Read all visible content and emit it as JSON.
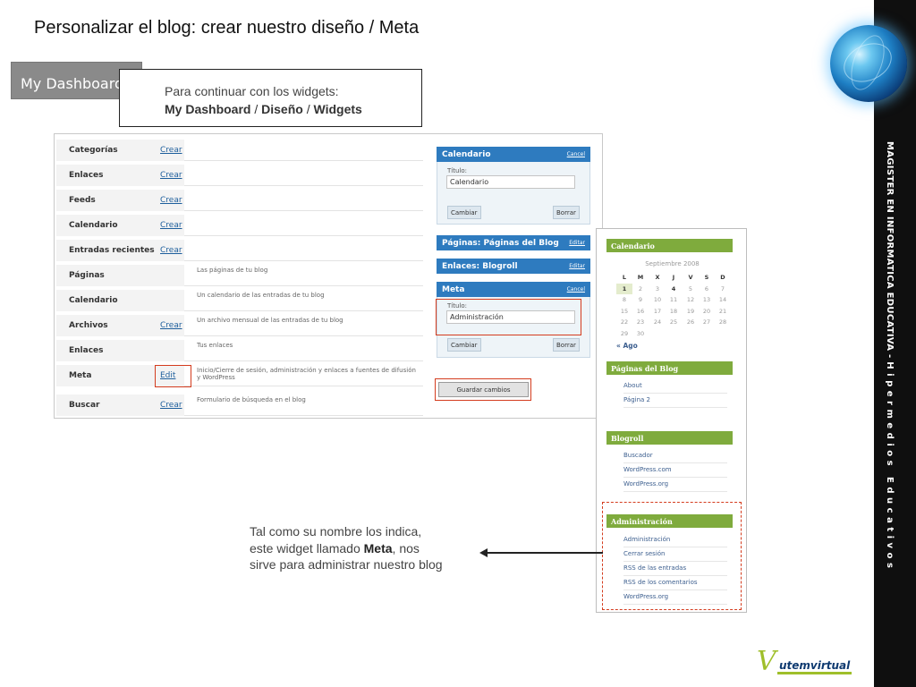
{
  "slide": {
    "title": "Personalizar el blog: crear nuestro diseño / Meta",
    "side_text_1": "MAGISTER EN INFORMATICA EDUCATIVA  -  ",
    "side_text_2": "Hipermedios Educativos",
    "logo_text": "utemvirtual"
  },
  "dashboard_button": {
    "label": "My Dashboard"
  },
  "callout": {
    "line1": "Para continuar con los widgets:",
    "path": [
      "My Dashboard",
      "Diseño",
      "Widgets"
    ],
    "separator": " / "
  },
  "widgets": [
    {
      "name": "Categorías",
      "link": "Crear",
      "desc": ""
    },
    {
      "name": "Enlaces",
      "link": "Crear",
      "desc": ""
    },
    {
      "name": "Feeds",
      "link": "Crear",
      "desc": ""
    },
    {
      "name": "Calendario",
      "link": "Crear",
      "desc": ""
    },
    {
      "name": "Entradas recientes",
      "link": "Crear",
      "desc": ""
    },
    {
      "name": "Páginas",
      "link": "",
      "desc": "Las páginas de tu blog"
    },
    {
      "name": "Calendario",
      "link": "",
      "desc": "Un calendario de las entradas de tu blog"
    },
    {
      "name": "Archivos",
      "link": "Crear",
      "desc": "Un archivo mensual de las entradas de tu blog"
    },
    {
      "name": "Enlaces",
      "link": "",
      "desc": "Tus enlaces"
    },
    {
      "name": "Meta",
      "link": "Edit",
      "desc": "Inicio/Cierre de sesión, administración y enlaces a fuentes de difusión y WordPress"
    },
    {
      "name": "Buscar",
      "link": "Crear",
      "desc": "Formulario de búsqueda en el blog"
    }
  ],
  "sidebar_widgets": {
    "calendar": {
      "title": "Calendario",
      "cancel": "Cancel",
      "title_label": "Título:",
      "title_value": "Calendario",
      "change": "Cambiar",
      "delete": "Borrar"
    },
    "pages": {
      "title": "Páginas: Páginas del Blog",
      "edit": "Editar"
    },
    "links": {
      "title": "Enlaces: Blogroll",
      "edit": "Editar"
    },
    "meta": {
      "title": "Meta",
      "cancel": "Cancel",
      "title_label": "Título:",
      "title_value": "Administración",
      "change": "Cambiar",
      "delete": "Borrar"
    },
    "save": "Guardar cambios"
  },
  "blog_preview": {
    "calendar_title": "Calendario",
    "month": "Septiembre 2008",
    "weekdays": [
      "L",
      "M",
      "X",
      "J",
      "V",
      "S",
      "D"
    ],
    "weeks": [
      [
        "1",
        "2",
        "3",
        "4",
        "5",
        "6",
        "7"
      ],
      [
        "8",
        "9",
        "10",
        "11",
        "12",
        "13",
        "14"
      ],
      [
        "15",
        "16",
        "17",
        "18",
        "19",
        "20",
        "21"
      ],
      [
        "22",
        "23",
        "24",
        "25",
        "26",
        "27",
        "28"
      ],
      [
        "29",
        "30",
        "",
        "",
        "",
        "",
        ""
      ]
    ],
    "prev": "« Ago",
    "pages_title": "Páginas del Blog",
    "pages": [
      "About",
      "Página 2"
    ],
    "blogroll_title": "Blogroll",
    "blogroll": [
      "Buscador",
      "WordPress.com",
      "WordPress.org"
    ],
    "admin_title": "Administración",
    "admin": [
      "Administración",
      "Cerrar sesión",
      "RSS de las entradas",
      "RSS de los comentarios",
      "WordPress.org"
    ]
  },
  "note": {
    "line1": "Tal como su nombre los indica,",
    "line2_pre": "este widget llamado ",
    "line2_bold": "Meta",
    "line2_post": ", nos",
    "line3": "sirve para administrar nuestro blog"
  }
}
